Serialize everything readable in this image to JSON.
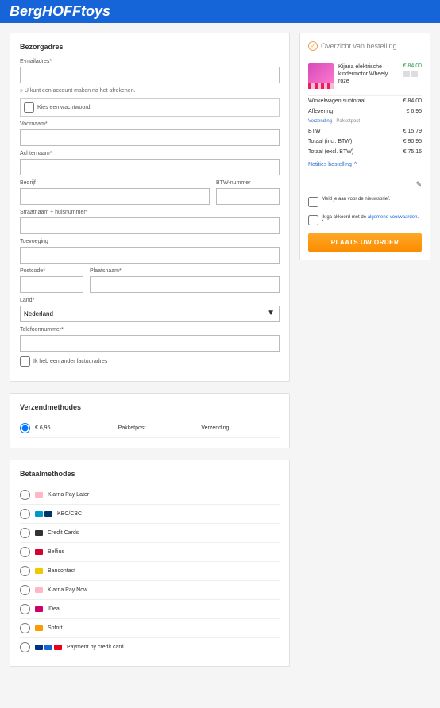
{
  "header": {
    "logo": "BergHOFFtoys"
  },
  "address": {
    "title": "Bezorgadres",
    "email_label": "E-mailadres",
    "hint": "» U kunt een account maken na het afrekenen.",
    "password_checkbox": "Kies een wachtwoord",
    "firstname_label": "Voornaam",
    "lastname_label": "Achternaam",
    "company_label": "Bedrijf",
    "vat_label": "BTW-nummer",
    "street_label": "Straatnaam + huisnummer",
    "addition_label": "Toevoeging",
    "postcode_label": "Postcode",
    "city_label": "Plaatsnaam",
    "country_label": "Land",
    "country_value": "Nederland",
    "phone_label": "Telefoonnummer",
    "diff_billing": "Ik heb een ander factuuradres"
  },
  "shipping": {
    "title": "Verzendmethodes",
    "rows": [
      {
        "price": "€ 6,95",
        "carrier": "Pakketpost",
        "method": "Verzending"
      }
    ]
  },
  "payment": {
    "title": "Betaalmethodes",
    "methods": [
      {
        "label": "Klarna Pay Later",
        "icons": [
          {
            "bg": "#ffb6c6"
          }
        ]
      },
      {
        "label": "KBC/CBC",
        "icons": [
          {
            "bg": "#0099cc"
          },
          {
            "bg": "#003366"
          }
        ]
      },
      {
        "label": "Credit Cards",
        "icons": [
          {
            "bg": "#333"
          }
        ]
      },
      {
        "label": "Belfius",
        "icons": [
          {
            "bg": "#d50032"
          }
        ]
      },
      {
        "label": "Bancontact",
        "icons": [
          {
            "bg": "#f0c800"
          }
        ]
      },
      {
        "label": "Klarna Pay Now",
        "icons": [
          {
            "bg": "#ffb6c6"
          }
        ]
      },
      {
        "label": "IDeal",
        "icons": [
          {
            "bg": "#cc0066"
          }
        ]
      },
      {
        "label": "Sofort",
        "icons": [
          {
            "bg": "#ff9900"
          }
        ]
      },
      {
        "label": "Payment by credit card.",
        "icons": [
          {
            "bg": "#003087"
          },
          {
            "bg": "#1565d8"
          },
          {
            "bg": "#eb001b"
          }
        ]
      }
    ]
  },
  "summary": {
    "title": "Overzicht van bestelling",
    "product": {
      "name": "Kijana elektrische kindermotor Wheely roze",
      "price": "€ 84,00"
    },
    "lines": {
      "subtotal_label": "Winkelwagen subtotaal",
      "subtotal": "€ 84,00",
      "shipping_label": "Aflevering",
      "shipping": "€ 6,95",
      "shipping_sub_l": "Verzending",
      "shipping_sub_r": "Pakketpost",
      "tax_label": "BTW",
      "tax": "€ 15,79",
      "total_incl_label": "Totaal (incl. BTW)",
      "total_incl": "€ 90,95",
      "total_excl_label": "Totaal (excl. BTW)",
      "total_excl": "€ 75,16"
    },
    "notes_label": "Notities bestelling",
    "newsletter": "Meld je aan voor de nieuwsbrief.",
    "terms_pre": "Ik ga akkoord met de ",
    "terms_link": "algemene voorwaarden",
    "terms_suf": ".",
    "button": "PLAATS UW ORDER"
  }
}
